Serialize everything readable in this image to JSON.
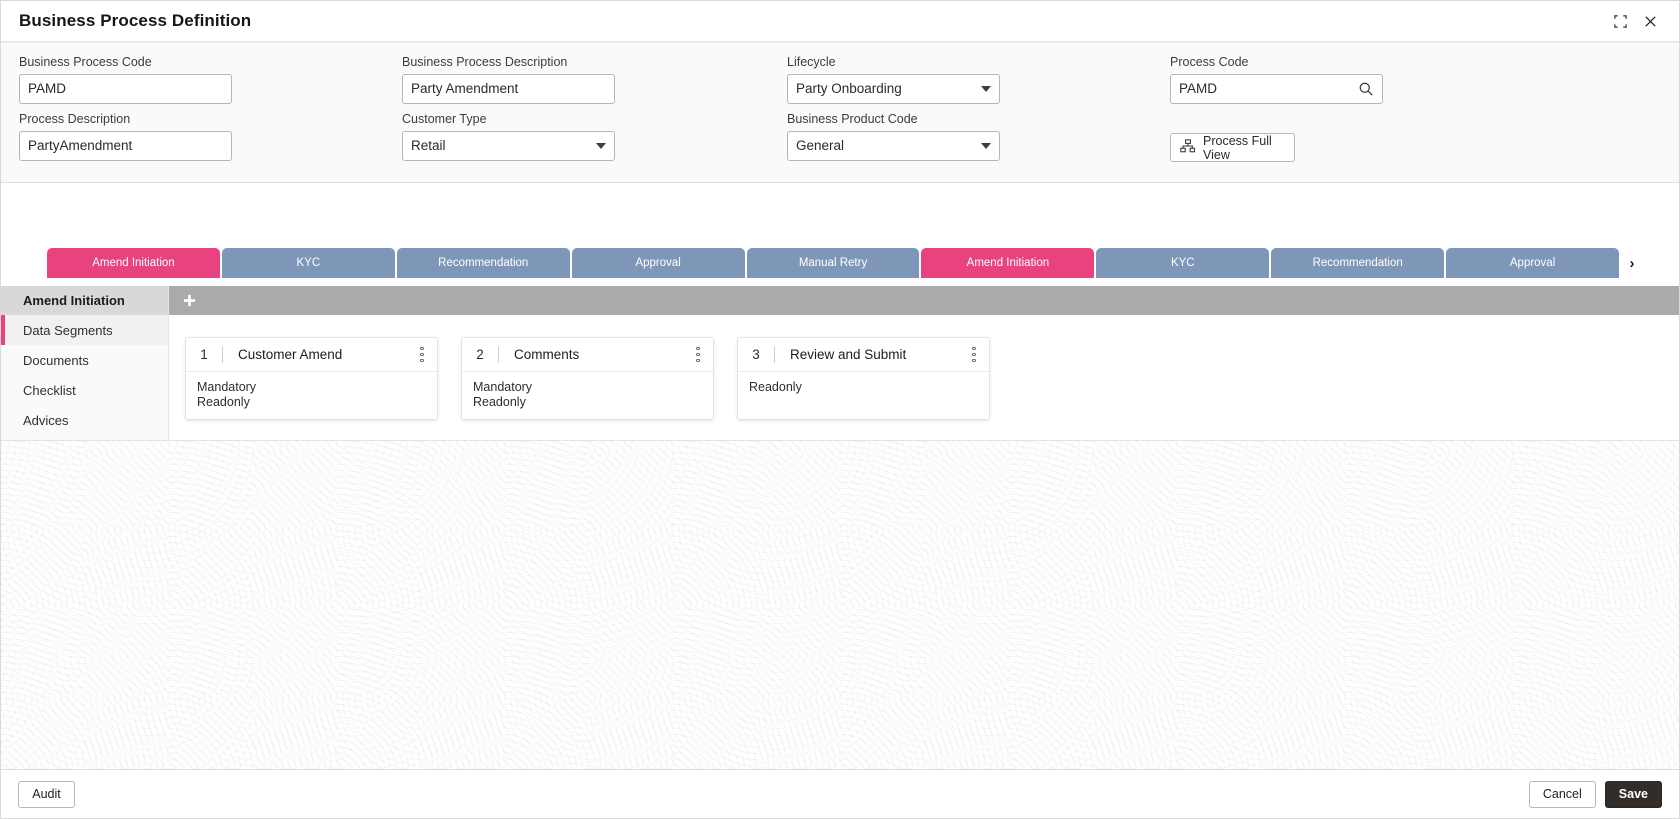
{
  "window": {
    "title": "Business Process Definition",
    "minimize_icon": "collapse-icon",
    "close_icon": "close-icon"
  },
  "form": {
    "fields": [
      {
        "label": "Business Process Code",
        "value": "PAMD",
        "type": "text"
      },
      {
        "label": "Business Process Description",
        "value": "Party Amendment",
        "type": "text"
      },
      {
        "label": "Lifecycle",
        "value": "Party Onboarding",
        "type": "select"
      },
      {
        "label": "Process Code",
        "value": "PAMD",
        "type": "search"
      },
      {
        "label": "Process Description",
        "value": "PartyAmendment",
        "type": "text"
      },
      {
        "label": "Customer Type",
        "value": "Retail",
        "type": "select"
      },
      {
        "label": "Business Product Code",
        "value": "General",
        "type": "select"
      }
    ],
    "process_full_view_label": "Process Full View",
    "process_full_view_icon": "org-chart-icon",
    "search_icon": "search-icon"
  },
  "stages": {
    "items": [
      {
        "label": "Amend Initiation",
        "active": true
      },
      {
        "label": "KYC",
        "active": false
      },
      {
        "label": "Recommendation",
        "active": false
      },
      {
        "label": "Approval",
        "active": false
      },
      {
        "label": "Manual Retry",
        "active": false
      },
      {
        "label": "Amend Initiation",
        "active": true
      },
      {
        "label": "KYC",
        "active": false
      },
      {
        "label": "Recommendation",
        "active": false
      },
      {
        "label": "Approval",
        "active": false
      }
    ],
    "next_arrow": "›",
    "active_color": "#e8437f",
    "inactive_color": "#7e97b8"
  },
  "sidebar": {
    "header": "Amend Initiation",
    "items": [
      {
        "label": "Data Segments",
        "selected": true
      },
      {
        "label": "Documents",
        "selected": false
      },
      {
        "label": "Checklist",
        "selected": false
      },
      {
        "label": "Advices",
        "selected": false
      }
    ]
  },
  "content": {
    "add_icon": "plus-icon",
    "cards": [
      {
        "number": "1",
        "title": "Customer Amend",
        "attributes": [
          "Mandatory",
          "Readonly"
        ],
        "menu_icon": "kebab-menu-icon"
      },
      {
        "number": "2",
        "title": "Comments",
        "attributes": [
          "Mandatory",
          "Readonly"
        ],
        "menu_icon": "kebab-menu-icon"
      },
      {
        "number": "3",
        "title": "Review and Submit",
        "attributes": [
          "Readonly"
        ],
        "menu_icon": "kebab-menu-icon"
      }
    ]
  },
  "footer": {
    "audit_label": "Audit",
    "cancel_label": "Cancel",
    "save_label": "Save"
  }
}
